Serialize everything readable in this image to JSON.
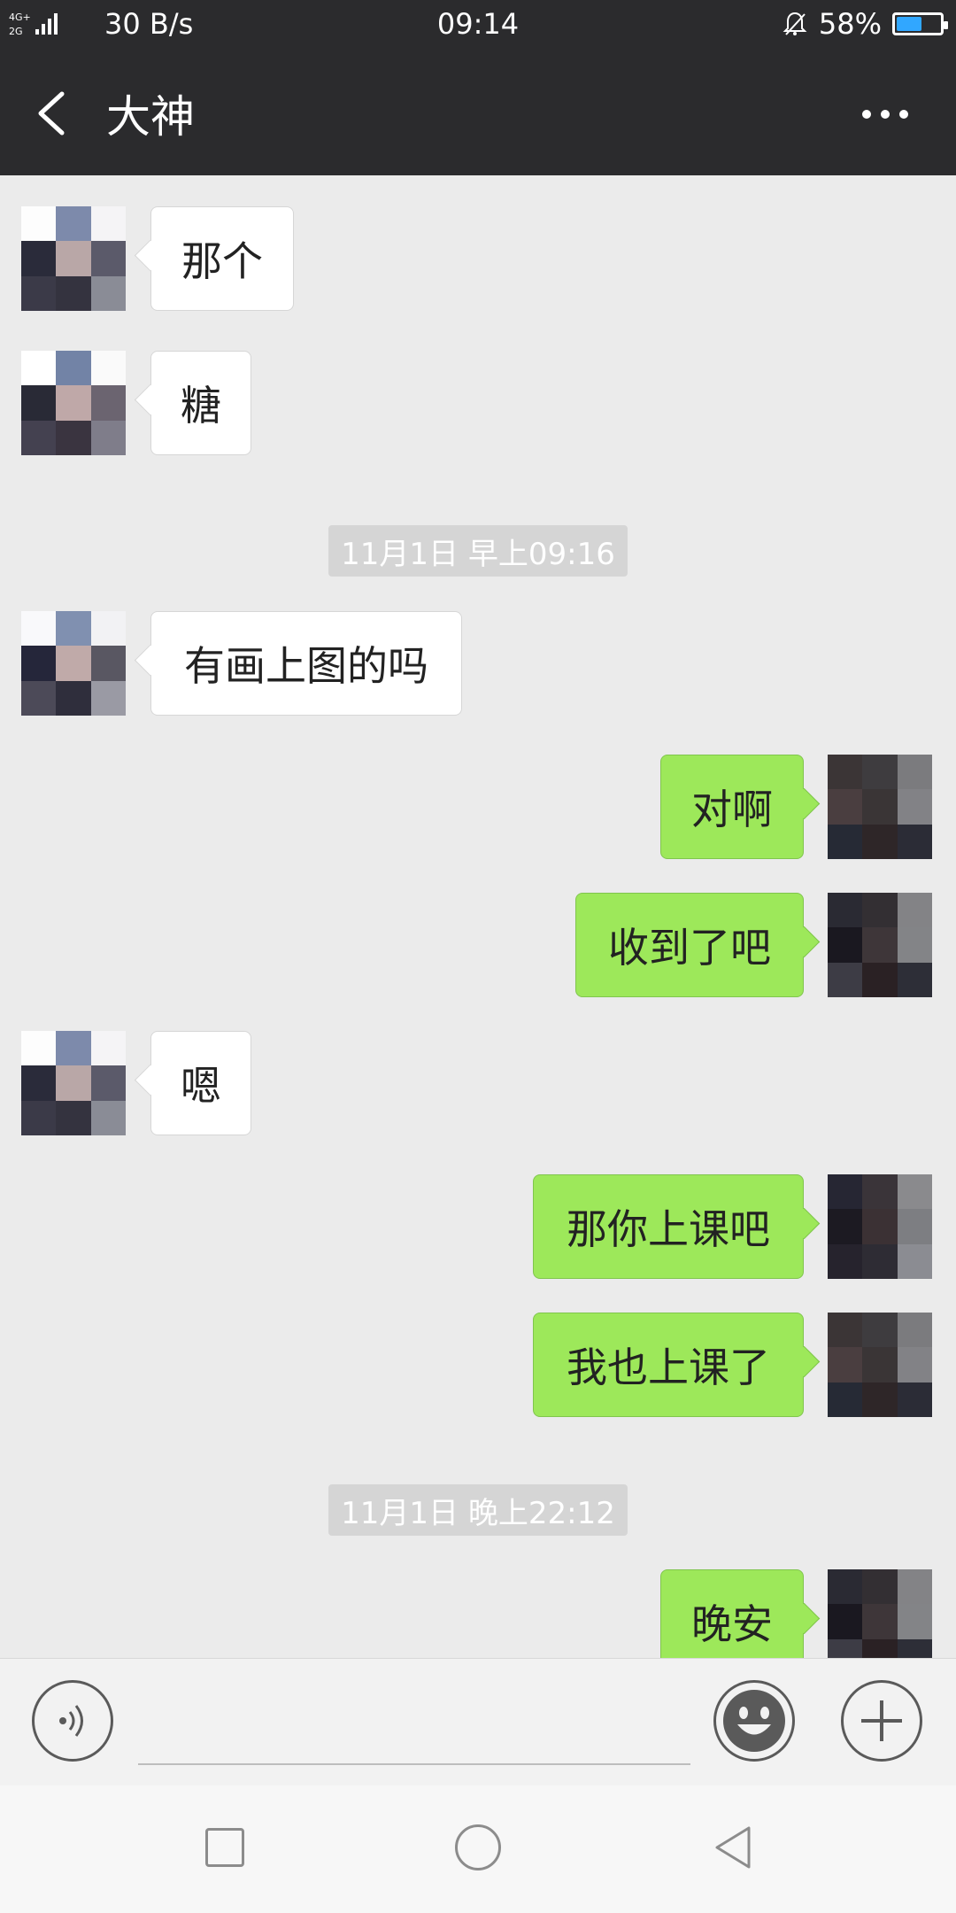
{
  "status_bar": {
    "signal_text": "4G+ 2G",
    "network_speed": "30 B/s",
    "time": "09:14",
    "battery_percent": "58%",
    "battery_level": 0.58,
    "battery_color": "#31a7ff",
    "icons": [
      "signal-icon",
      "mute-bell-icon",
      "battery-icon"
    ]
  },
  "header": {
    "title": "大神",
    "back_icon": "chevron-left-icon",
    "menu_icon": "more-dots-icon"
  },
  "messages": [
    {
      "dir": "in",
      "text": "那个"
    },
    {
      "dir": "in",
      "text": "糖"
    },
    {
      "type": "time",
      "text": "11月1日 早上09:16"
    },
    {
      "dir": "in",
      "text": "有画上图的吗"
    },
    {
      "dir": "out",
      "text": "对啊"
    },
    {
      "dir": "out",
      "text": "收到了吧"
    },
    {
      "dir": "in",
      "text": "嗯"
    },
    {
      "dir": "out",
      "text": "那你上课吧"
    },
    {
      "dir": "out",
      "text": "我也上课了"
    },
    {
      "type": "time",
      "text": "11月1日 晚上22:12"
    },
    {
      "dir": "out",
      "text": "晚安"
    }
  ],
  "colors": {
    "header_bg": "#2b2b2d",
    "chat_bg": "#ebebeb",
    "outgoing_bubble": "#9de85a",
    "incoming_bubble": "#ffffff"
  },
  "input_bar": {
    "voice_icon": "voice-icon",
    "emoji_icon": "emoji-icon",
    "plus_icon": "plus-icon",
    "input_value": ""
  },
  "nav_bar": {
    "icons": [
      "recent-apps-icon",
      "home-icon",
      "back-icon"
    ]
  }
}
